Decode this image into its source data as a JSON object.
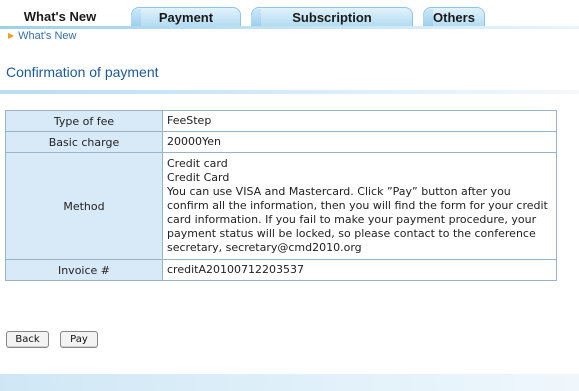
{
  "tabs": [
    {
      "label": "What's New",
      "active": true
    },
    {
      "label": "Payment",
      "active": false
    },
    {
      "label": "Subscription",
      "active": false
    },
    {
      "label": "Others",
      "active": false
    }
  ],
  "breadcrumb": {
    "label": "What's New"
  },
  "page": {
    "title": "Confirmation of payment"
  },
  "table": {
    "rows": [
      {
        "label": "Type of fee",
        "value": "FeeStep"
      },
      {
        "label": "Basic charge",
        "value": "20000Yen"
      },
      {
        "label": "Method",
        "lines": [
          "Credit card",
          "Credit Card",
          "You can use VISA and Mastercard. Click ”Pay” button after you confirm all the information, then you will find the form for your credit card information. If you fail to make your payment procedure, your payment status will be locked, so please contact to the conference secretary, secretary@cmd2010.org"
        ]
      },
      {
        "label": "Invoice #",
        "value": "creditA20100712203537"
      }
    ]
  },
  "buttons": {
    "back": "Back",
    "pay": "Pay"
  },
  "colors": {
    "tab_gradient": "#b3dcf2",
    "label_cell": "#d8eaf8",
    "title": "#1a5a9a",
    "link": "#3a6ea5",
    "bullet": "#f0a020"
  }
}
